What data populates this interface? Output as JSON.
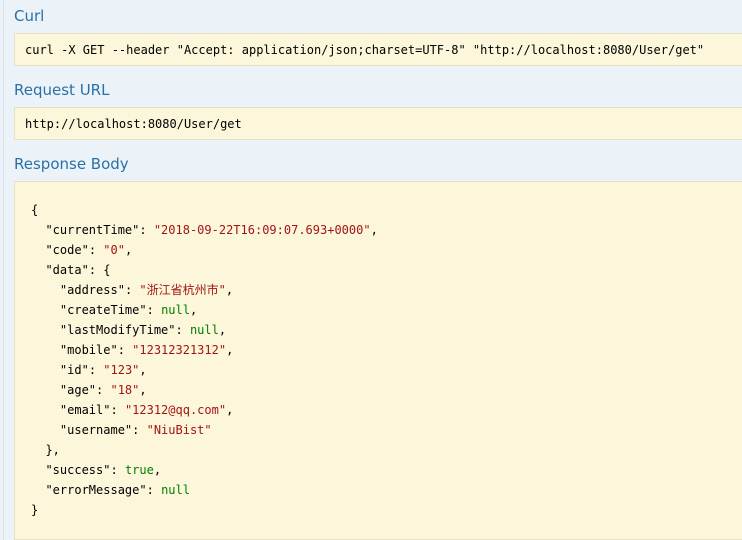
{
  "sections": {
    "curl": {
      "title": "Curl",
      "command": "curl -X GET --header \"Accept: application/json;charset=UTF-8\" \"http://localhost:8080/User/get\""
    },
    "request_url": {
      "title": "Request URL",
      "url": "http://localhost:8080/User/get"
    },
    "response_body": {
      "title": "Response Body",
      "open_brace": "{",
      "close_brace": "}",
      "currentTime": {
        "key": "\"currentTime\"",
        "value": "\"2018-09-22T16:09:07.693+0000\""
      },
      "code": {
        "key": "\"code\"",
        "value": "\"0\""
      },
      "data": {
        "key": "\"data\"",
        "open": "{",
        "close": "},",
        "address": {
          "key": "\"address\"",
          "value": "\"浙江省杭州市\""
        },
        "createTime": {
          "key": "\"createTime\"",
          "value": "null"
        },
        "lastModifyTime": {
          "key": "\"lastModifyTime\"",
          "value": "null"
        },
        "mobile": {
          "key": "\"mobile\"",
          "value": "\"12312321312\""
        },
        "id": {
          "key": "\"id\"",
          "value": "\"123\""
        },
        "age": {
          "key": "\"age\"",
          "value": "\"18\""
        },
        "email": {
          "key": "\"email\"",
          "value": "\"12312@qq.com\""
        },
        "username": {
          "key": "\"username\"",
          "value": "\"NiuBist\""
        }
      },
      "success": {
        "key": "\"success\"",
        "value": "true"
      },
      "errorMessage": {
        "key": "\"errorMessage\"",
        "value": "null"
      }
    }
  },
  "colors": {
    "background": "#ebf3f9",
    "title": "#2a70a6",
    "code_background": "#fcf6db",
    "string": "#a31515",
    "literal": "#008000"
  }
}
